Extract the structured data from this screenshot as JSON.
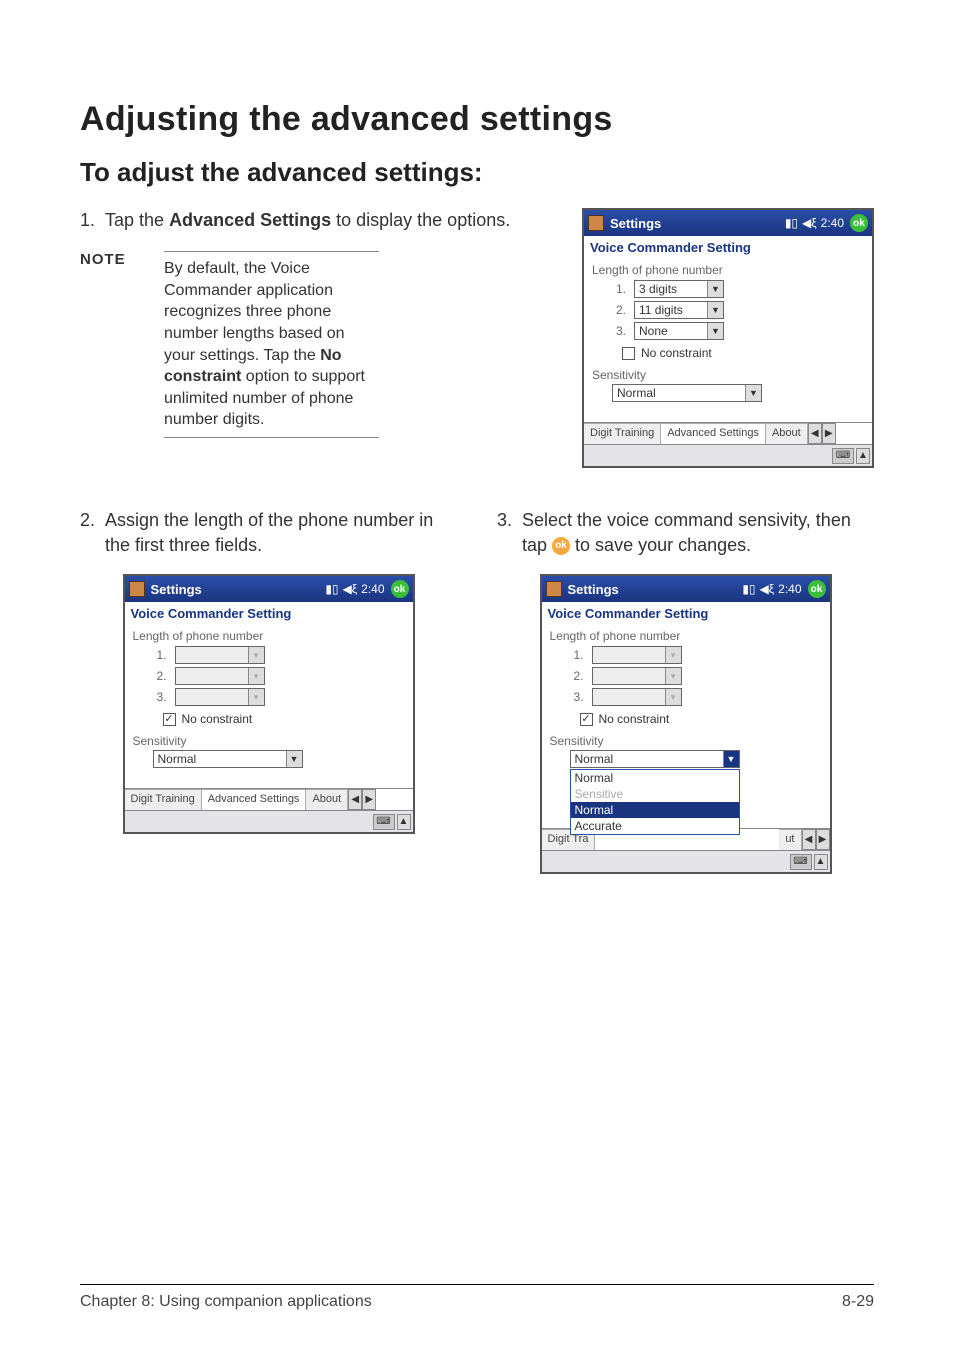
{
  "page": {
    "title": "Adjusting the advanced settings",
    "subtitle": "To adjust the advanced settings:"
  },
  "steps": {
    "s1_num": "1.",
    "s1_pre": "Tap the ",
    "s1_bold": "Advanced Settings",
    "s1_post": " to display the options.",
    "s2_num": "2.",
    "s2_text": "Assign the length of the phone number in the first three fields.",
    "s3_num": "3.",
    "s3_pre": "Select the voice command sensivity, then tap ",
    "s3_post": " to save your changes."
  },
  "note": {
    "label": "NOTE",
    "pre": "By default, the Voice Commander application recognizes three phone number lengths based on your settings. Tap the ",
    "bold": "No constraint",
    "post": " option to support unlimited number of phone number digits."
  },
  "device_common": {
    "title": "Settings",
    "time": "2:40",
    "ok": "ok",
    "header": "Voice Commander Setting",
    "length_label": "Length of phone number",
    "idx1": "1.",
    "idx2": "2.",
    "idx3": "3.",
    "no_constraint": "No constraint",
    "sensitivity_label": "Sensitivity",
    "tab_digit": "Digit Training",
    "tab_adv": "Advanced Settings",
    "tab_about": "About",
    "tab_about_cut": "ut"
  },
  "device1": {
    "v1": "3 digits",
    "v2": "11 digits",
    "v3": "None",
    "no_constraint_checked": false,
    "sensitivity": "Normal"
  },
  "device2": {
    "no_constraint_checked": true,
    "sensitivity": "Normal"
  },
  "device3": {
    "no_constraint_checked": true,
    "sensitivity": "Normal",
    "options": {
      "o1": "Normal",
      "o2": "Sensitive",
      "o3": "Normal",
      "o4": "Accurate"
    },
    "tab_digit_cut": "Digit Tra"
  },
  "ok_inline": "ok",
  "footer": {
    "left": "Chapter 8: Using companion applications",
    "right": "8-29"
  }
}
